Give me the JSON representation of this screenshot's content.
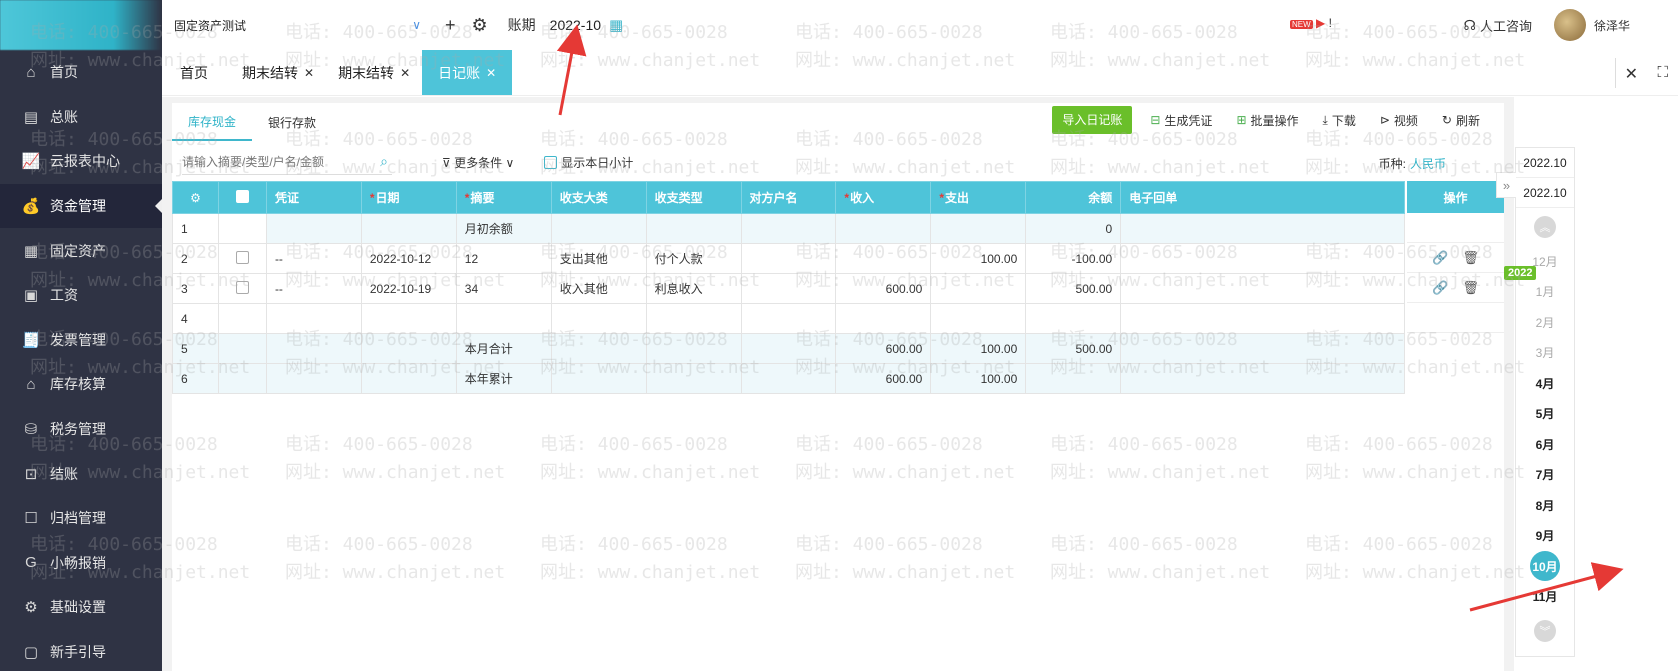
{
  "company": "固定资产测试",
  "period": {
    "label": "账期",
    "value": "2022-10"
  },
  "sidebar": {
    "items": [
      {
        "label": "首页",
        "icon": "home-icon",
        "glyph": "⌂"
      },
      {
        "label": "总账",
        "icon": "ledger-icon",
        "glyph": "▤"
      },
      {
        "label": "云报表中心",
        "icon": "chart-icon",
        "glyph": "📈"
      },
      {
        "label": "资金管理",
        "icon": "money-bag-icon",
        "glyph": "💰"
      },
      {
        "label": "固定资产",
        "icon": "asset-icon",
        "glyph": "▦"
      },
      {
        "label": "工资",
        "icon": "wallet-icon",
        "glyph": "▣"
      },
      {
        "label": "发票管理",
        "icon": "invoice-icon",
        "glyph": "🧾"
      },
      {
        "label": "库存核算",
        "icon": "warehouse-icon",
        "glyph": "⌂"
      },
      {
        "label": "税务管理",
        "icon": "tax-icon",
        "glyph": "⛁"
      },
      {
        "label": "结账",
        "icon": "checkout-icon",
        "glyph": "⊡"
      },
      {
        "label": "归档管理",
        "icon": "archive-icon",
        "glyph": "☐"
      },
      {
        "label": "小畅报销",
        "icon": "reimburse-icon",
        "glyph": "G"
      },
      {
        "label": "基础设置",
        "icon": "settings-icon",
        "glyph": "⚙"
      },
      {
        "label": "新手引导",
        "icon": "guide-icon",
        "glyph": "▢"
      }
    ],
    "active_index": 3
  },
  "header": {
    "consult": "人工咨询",
    "user": "徐泽华",
    "new_badge": "NEW"
  },
  "tabs": [
    {
      "label": "首页",
      "closable": false
    },
    {
      "label": "期末结转",
      "closable": true
    },
    {
      "label": "期末结转",
      "closable": true
    },
    {
      "label": "日记账",
      "closable": true,
      "active": true
    }
  ],
  "subtabs": [
    "库存现金",
    "银行存款"
  ],
  "actions": {
    "import": "导入日记账",
    "gen_voucher": "生成凭证",
    "batch": "批量操作",
    "download": "下载",
    "video": "视频",
    "refresh": "刷新"
  },
  "filters": {
    "search_placeholder": "请输入摘要/类型/户名/金额",
    "more": "更多条件",
    "show_day": "显示本日小计",
    "currency_label": "币种:",
    "currency_value": "人民币"
  },
  "table": {
    "headers": {
      "voucher": "凭证",
      "date": "日期",
      "summary": "摘要",
      "category": "收支大类",
      "type": "收支类型",
      "counterparty": "对方户名",
      "income": "收入",
      "expense": "支出",
      "balance": "余额",
      "receipt": "电子回单",
      "ops": "操作"
    },
    "rows": [
      {
        "n": "1",
        "voucher": "",
        "date": "",
        "summary": "月初余额",
        "category": "",
        "type": "",
        "cp": "",
        "income": "",
        "expense": "",
        "balance": "0"
      },
      {
        "n": "2",
        "voucher": "--",
        "date": "2022-10-12",
        "summary": "12",
        "category": "支出其他",
        "type": "付个人款",
        "cp": "",
        "income": "",
        "expense": "100.00",
        "balance": "-100.00"
      },
      {
        "n": "3",
        "voucher": "--",
        "date": "2022-10-19",
        "summary": "34",
        "category": "收入其他",
        "type": "利息收入",
        "cp": "",
        "income": "600.00",
        "expense": "",
        "balance": "500.00"
      },
      {
        "n": "4",
        "voucher": "",
        "date": "",
        "summary": "",
        "category": "",
        "type": "",
        "cp": "",
        "income": "",
        "expense": "",
        "balance": ""
      },
      {
        "n": "5",
        "voucher": "",
        "date": "",
        "summary": "本月合计",
        "category": "",
        "type": "",
        "cp": "",
        "income": "600.00",
        "expense": "100.00",
        "balance": "500.00"
      },
      {
        "n": "6",
        "voucher": "",
        "date": "",
        "summary": "本年累计",
        "category": "",
        "type": "",
        "cp": "",
        "income": "600.00",
        "expense": "100.00",
        "balance": ""
      }
    ]
  },
  "period_panel": {
    "start": "2022.10",
    "end": "2022.10",
    "year_badge": "2022",
    "months": [
      "12月",
      "1月",
      "2月",
      "3月",
      "4月",
      "5月",
      "6月",
      "7月",
      "8月",
      "9月",
      "10月",
      "11月"
    ],
    "selected": "10月"
  },
  "watermark": {
    "phone": "电话: 400-665-0028",
    "site": "网址: www.chanjet.net"
  }
}
